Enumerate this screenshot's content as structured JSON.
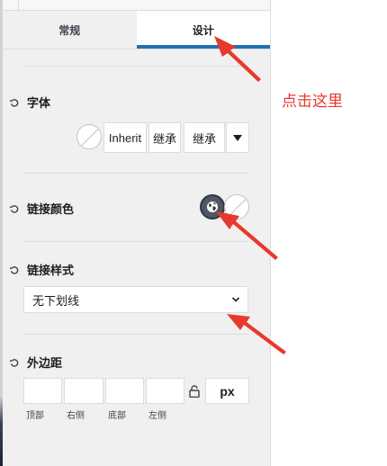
{
  "tabs": [
    {
      "label": "常规",
      "active": false
    },
    {
      "label": "设计",
      "active": true
    }
  ],
  "font": {
    "label": "字体",
    "family": "Inherit",
    "weight": "继承",
    "style": "继承"
  },
  "link_color": {
    "label": "链接颜色"
  },
  "link_style": {
    "label": "链接样式",
    "selected": "无下划线"
  },
  "margin": {
    "label": "外边距",
    "unit": "px",
    "sides": [
      "顶部",
      "右侧",
      "底部",
      "左侧"
    ]
  },
  "annotation": {
    "text": "点击这里"
  },
  "colors": {
    "accent": "#2271b1",
    "arrow": "#e8392e"
  }
}
